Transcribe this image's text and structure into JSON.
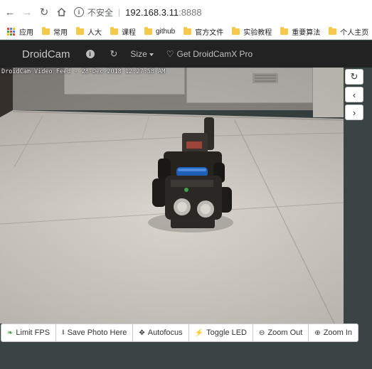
{
  "browser": {
    "security_label": "不安全",
    "host": "192.168.3.11",
    "port": ":8888",
    "bookmarks": [
      {
        "label": "应用"
      },
      {
        "label": "常用"
      },
      {
        "label": "人大"
      },
      {
        "label": "课程"
      },
      {
        "label": "github"
      },
      {
        "label": "官方文件"
      },
      {
        "label": "实验教程"
      },
      {
        "label": "重要算法"
      },
      {
        "label": "个人主页"
      }
    ]
  },
  "app": {
    "brand": "DroidCam",
    "size_label": "Size",
    "get_pro_label": "Get DroidCamX Pro"
  },
  "feed": {
    "caption": "DroidCam Video Feed - 28-Dec-2018 12:27:58 AM"
  },
  "toolbar": {
    "limit_fps": "Limit FPS",
    "save_photo": "Save Photo Here",
    "autofocus": "Autofocus",
    "toggle_led": "Toggle LED",
    "zoom_out": "Zoom Out",
    "zoom_in": "Zoom In"
  },
  "colors": {
    "navbar_bg": "#222222",
    "page_bg": "#3a4444",
    "bookmark_folder": "#f6c94b",
    "limit_fps_icon": "#3c9a3c"
  },
  "icons": {
    "back": "arrow-left-icon",
    "forward": "arrow-right-icon",
    "reload": "reload-icon",
    "home": "home-icon",
    "info": "info-icon",
    "refresh": "refresh-icon",
    "heart": "heart-icon",
    "prev": "chevron-left-icon",
    "next": "chevron-right-icon"
  }
}
